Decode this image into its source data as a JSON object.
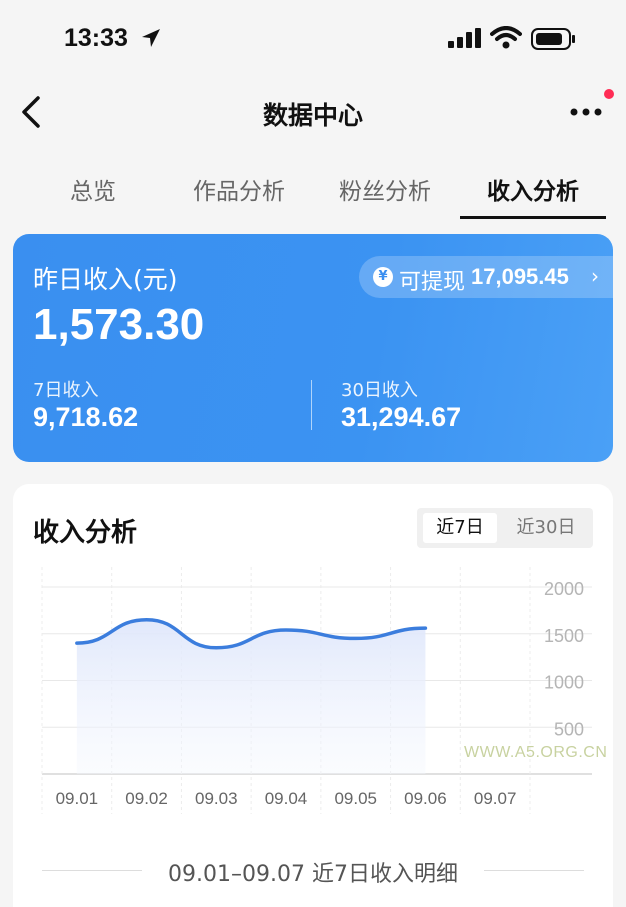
{
  "status_bar": {
    "time": "13:33"
  },
  "nav": {
    "title": "数据中心"
  },
  "tabs": [
    {
      "label": "总览"
    },
    {
      "label": "作品分析"
    },
    {
      "label": "粉丝分析"
    },
    {
      "label": "收入分析"
    }
  ],
  "income": {
    "yesterday_label": "昨日收入(元)",
    "yesterday_value": "1,573.30",
    "withdraw_label": "可提现",
    "withdraw_value": "17,095.45",
    "yen_symbol": "¥",
    "chevron": "›",
    "week_label": "7日收入",
    "week_value": "9,718.62",
    "month_label": "30日收入",
    "month_value": "31,294.67"
  },
  "analysis": {
    "title": "收入分析",
    "range_options": [
      "近7日",
      "近30日"
    ],
    "selected_range": "近7日"
  },
  "chart_data": {
    "type": "area",
    "categories": [
      "09.01",
      "09.02",
      "09.03",
      "09.04",
      "09.05",
      "09.06",
      "09.07"
    ],
    "series": [
      {
        "values": [
          1400,
          1650,
          1350,
          1540,
          1450,
          1560,
          null
        ]
      }
    ],
    "y_ticks": [
      2000,
      1500,
      1000,
      500
    ],
    "ylim": [
      0,
      2000
    ],
    "grid": true,
    "line_color": "#3b7ddd"
  },
  "watermark": "WWW.A5.ORG.CN",
  "detail": {
    "title": "09.01–09.07 近7日收入明细"
  },
  "colors": {
    "accent": "#3b8ff0",
    "notify_dot": "#ff2c55"
  }
}
